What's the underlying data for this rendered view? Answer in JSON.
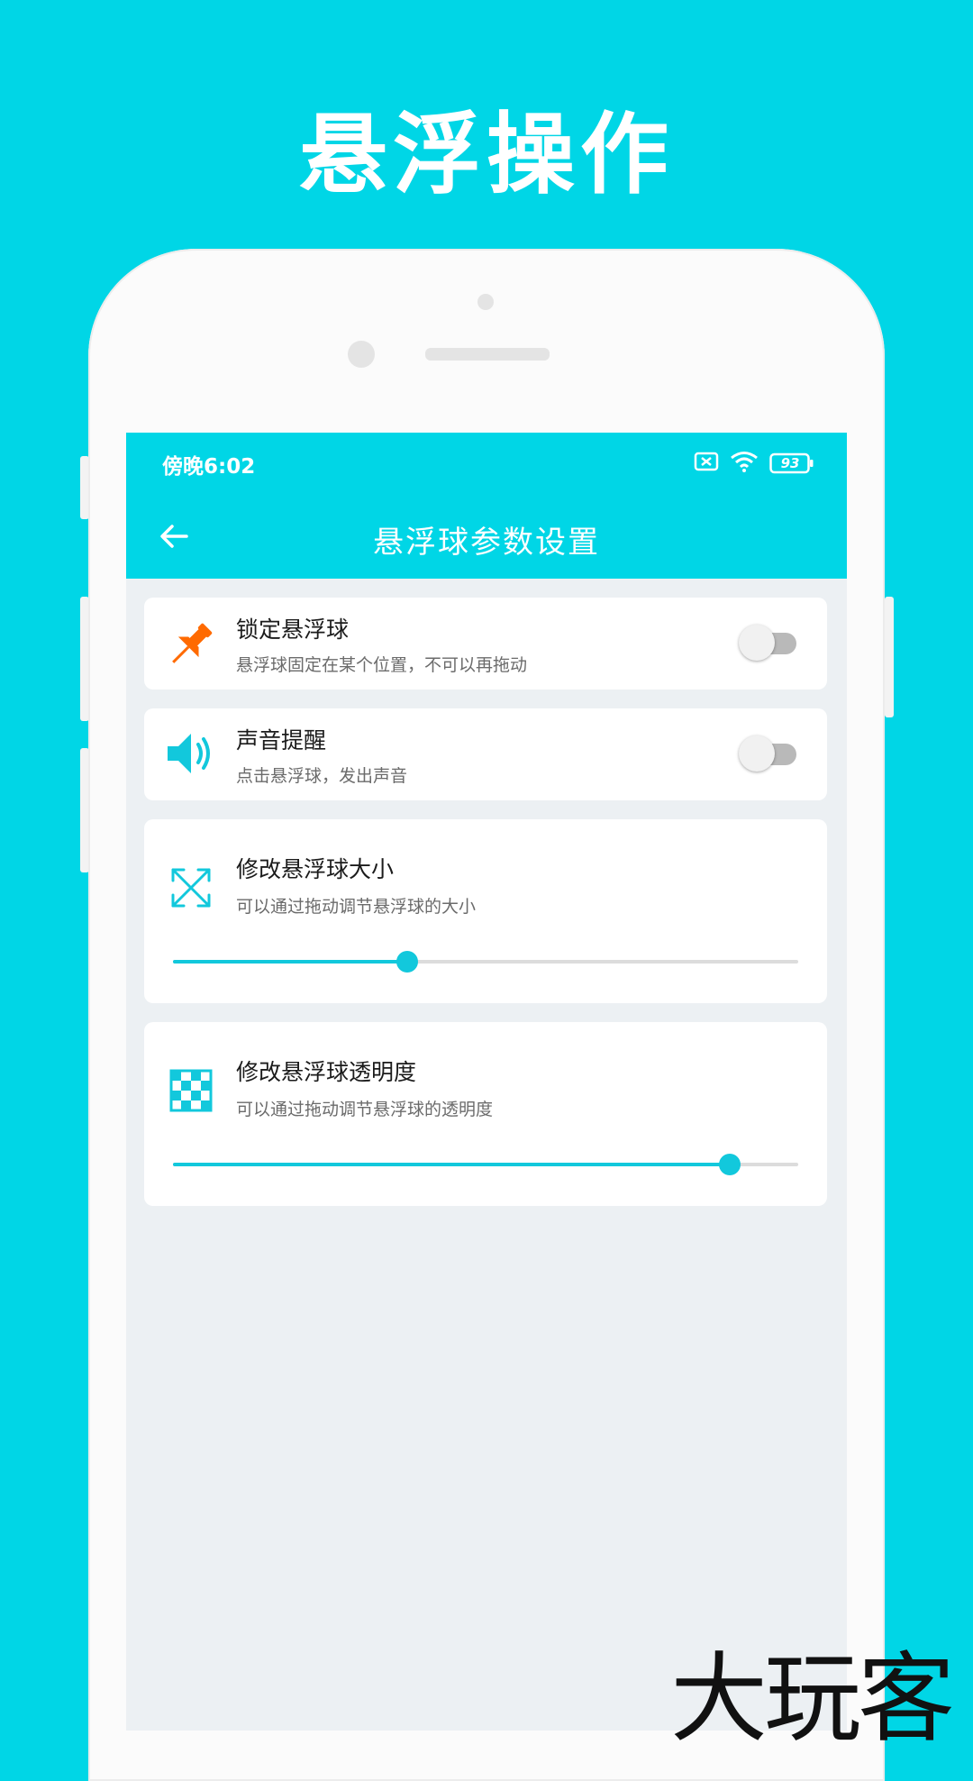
{
  "headline": "悬浮操作",
  "status_bar": {
    "time": "傍晚6:02",
    "battery": "93"
  },
  "app_bar": {
    "title": "悬浮球参数设置",
    "back_icon": "arrow-left-icon"
  },
  "settings": [
    {
      "title": "锁定悬浮球",
      "desc": "悬浮球固定在某个位置，不可以再拖动",
      "icon": "pushpin-icon",
      "toggle_on": false
    },
    {
      "title": "声音提醒",
      "desc": "点击悬浮球，发出声音",
      "icon": "speaker-icon",
      "toggle_on": false
    },
    {
      "title": "修改悬浮球大小",
      "desc": "可以通过拖动调节悬浮球的大小",
      "icon": "resize-arrows-icon",
      "slider_value": 0.375
    },
    {
      "title": "修改悬浮球透明度",
      "desc": "可以通过拖动调节悬浮球的透明度",
      "icon": "checkerboard-icon",
      "slider_value": 0.89
    }
  ],
  "colors": {
    "accent": "#00d6e6",
    "slider": "#12c8dc",
    "pin": "#ff6a00",
    "card": "#ffffff",
    "background": "#ecf0f3"
  },
  "watermark": "大玩客"
}
